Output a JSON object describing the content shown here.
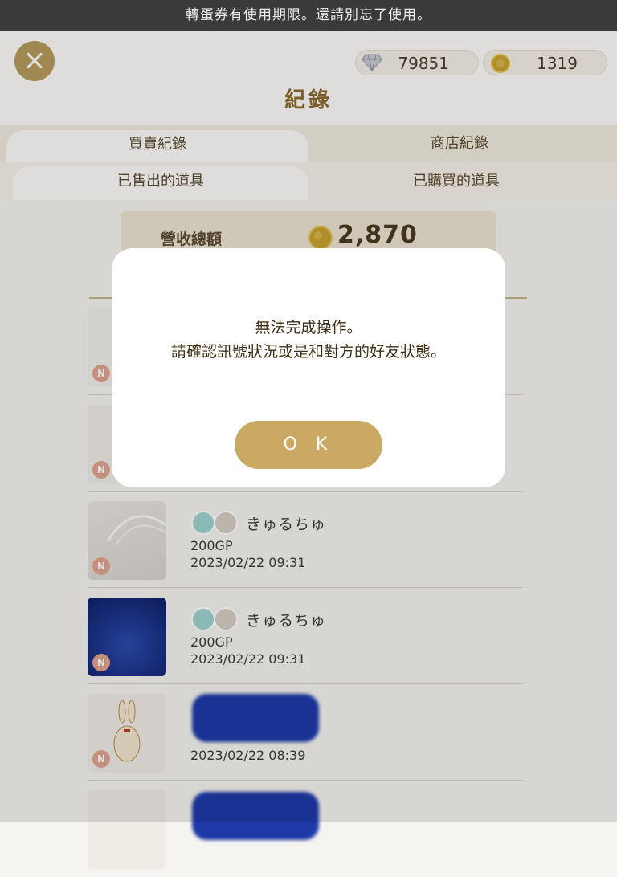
{
  "banner": "轉蛋券有使用期限。還請別忘了使用。",
  "header": {
    "title": "紀錄",
    "gems": "79851",
    "coins": "1319"
  },
  "tabs_primary": [
    "買賣紀錄",
    "商店紀錄"
  ],
  "tabs_secondary": [
    "已售出的道具",
    "已購買的道具"
  ],
  "summary": {
    "label": "營收總額",
    "amount": "2,870"
  },
  "list": [
    {
      "user": "",
      "price": "",
      "date": ""
    },
    {
      "user": "",
      "price": "",
      "date": ""
    },
    {
      "user": "きゅるちゅ",
      "price": "200GP",
      "date": "2023/02/22 09:31",
      "badge": "N"
    },
    {
      "user": "きゅるちゅ",
      "price": "200GP",
      "date": "2023/02/22 09:31",
      "badge": "N"
    },
    {
      "user": "",
      "price": "",
      "date": "2023/02/22 08:39",
      "badge": "N"
    }
  ],
  "badge_letter": "N",
  "dialog": {
    "line1": "無法完成操作。",
    "line2": "請確認訊號狀況或是和對方的好友狀態。",
    "ok": "O K"
  },
  "colors": {
    "accent": "#caa962",
    "title": "#8a6a2c",
    "banner_bg": "#3a3a3a"
  }
}
